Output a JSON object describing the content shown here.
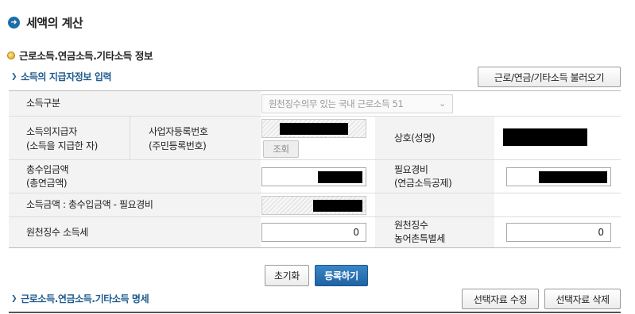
{
  "page_title": "세액의 계산",
  "section_title": "근로소득.연금소득.기타소득 정보",
  "payer_link": "소득의 지급자정보 입력",
  "load_button": "근로/연금/기타소득 불러오기",
  "form": {
    "income_type": {
      "label": "소득구분",
      "selected": "원천징수의무 있는 국내 근로소득 51"
    },
    "payer": {
      "label_line1": "소득의지급자",
      "label_line2": "(소득을 지급한 자)",
      "reg_label_line1": "사업자등록번호",
      "reg_label_line2": "(주민등록번호)",
      "lookup_button": "조회",
      "name_label": "상호(성명)"
    },
    "total_income": {
      "label_line1": "총수입금액",
      "label_line2": "(총연금액)",
      "expense_label_line1": "필요경비",
      "expense_label_line2": "(연금소득공제)"
    },
    "income_amount": {
      "label": "소득금액 : 총수입금액 - 필요경비"
    },
    "withholding": {
      "label": "원천징수 소득세",
      "value": "0",
      "rural_label_line1": "원천징수",
      "rural_label_line2": "농어촌특별세",
      "rural_value": "0"
    }
  },
  "buttons": {
    "reset": "초기화",
    "register": "등록하기",
    "edit_selected": "선택자료 수정",
    "delete_selected": "선택자료 삭제"
  },
  "detail_link": "근로소득.연금소득.기타소득 명세",
  "colors": {
    "accent": "#1b6ea8",
    "link": "#1d5a8f",
    "primary_button": "#2a72b5",
    "label_bg": "#f3f3f3"
  }
}
